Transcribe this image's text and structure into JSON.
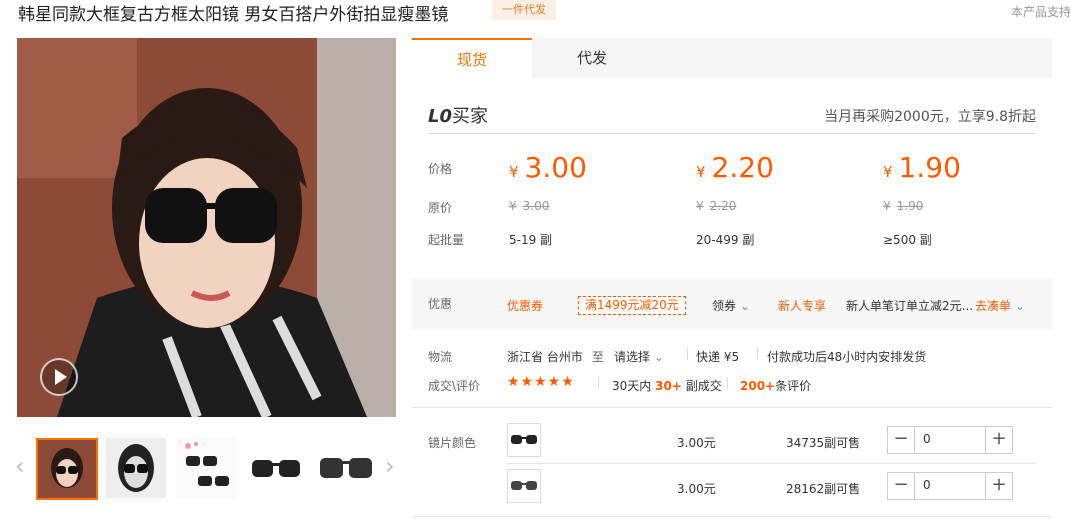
{
  "header": {
    "title": "韩星同款大框复古方框太阳镜 男女百搭户外街拍显瘦墨镜",
    "badge": "一件代发",
    "support_text": "本产品支持"
  },
  "tabs": [
    {
      "label": "现货"
    },
    {
      "label": "代发"
    }
  ],
  "buyer": {
    "level": "L0",
    "label": "买家",
    "promo_note": "当月再采购2000元，立享9.8折起"
  },
  "pricing": {
    "price_label": "价格",
    "orig_label": "原价",
    "qty_label": "起批量",
    "currency": "¥",
    "tiers": [
      {
        "price": "3.00",
        "orig": "3.00",
        "qty": "5-19 副"
      },
      {
        "price": "2.20",
        "orig": "2.20",
        "qty": "20-499 副"
      },
      {
        "price": "1.90",
        "orig": "1.90",
        "qty": "≥500 副"
      }
    ]
  },
  "discount": {
    "label": "优惠",
    "coupon_label": "优惠券",
    "coupon_text": "满1499元减20元",
    "claim": "领券",
    "newcomer": "新人专享",
    "newcomer_text": "新人单笔订单立减2元...",
    "go_order": "去凑单"
  },
  "logistics": {
    "label": "物流",
    "origin": "浙江省 台州市",
    "to": "至",
    "select": "请选择",
    "express": "快递 ¥5",
    "ship_note": "付款成功后48小时内安排发货"
  },
  "reviews": {
    "label": "成交\\评价",
    "stars": "★★★★★",
    "days_text": "30天内",
    "deals_count": "30+",
    "deals_text": "副成交",
    "review_count": "200+",
    "review_text": "条评价"
  },
  "variants": {
    "label": "镜片颜色",
    "rows": [
      {
        "price": "3.00元",
        "stock": "34735副可售",
        "qty": "0"
      },
      {
        "price": "3.00元",
        "stock": "28162副可售",
        "qty": "0"
      }
    ]
  },
  "icons": {
    "prev": "‹",
    "next": "›",
    "minus": "−",
    "plus": "+",
    "chevron": "⌄"
  },
  "colors": {
    "accent": "#ff7200",
    "price": "#ff5a00",
    "badge_bg": "#fcefe6"
  }
}
